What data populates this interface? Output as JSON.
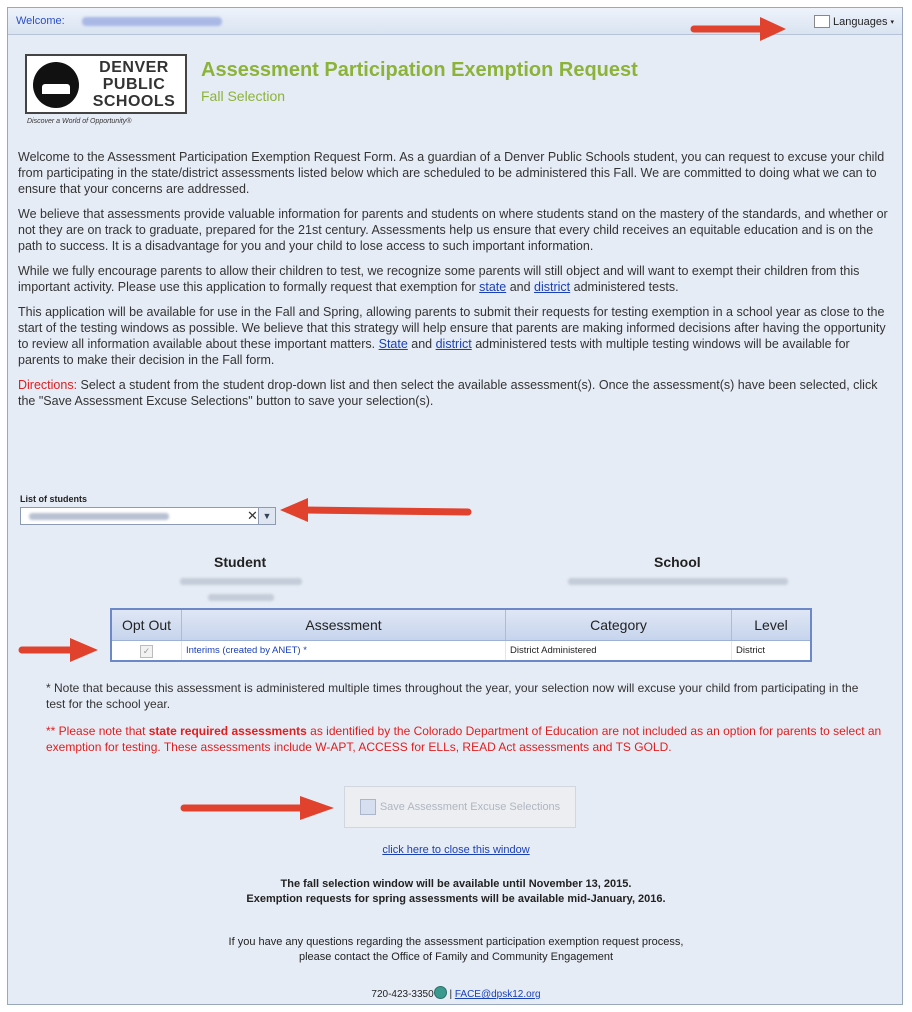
{
  "header": {
    "welcome_label": "Welcome:",
    "languages_label": "Languages"
  },
  "logo": {
    "line1": "DENVER",
    "line2": "PUBLIC",
    "line3": "SCHOOLS",
    "tagline": "Discover a World of Opportunity®"
  },
  "page": {
    "title": "Assessment Participation Exemption Request",
    "subtitle": "Fall Selection"
  },
  "intro": {
    "p1": "Welcome to the Assessment Participation Exemption Request Form. As a guardian of a Denver Public Schools student, you can request to excuse your child from participating in the state/district assessments listed below which are scheduled to be administered this Fall. We are committed to doing what we can to ensure that your concerns are addressed.",
    "p2": "We believe that assessments provide valuable information for parents and students on where students stand on the mastery of the standards, and whether or not they are on track to graduate, prepared for the 21st century. Assessments help us ensure that every child receives an equitable education and is on the path to success. It is a disadvantage for you and your child to lose access to such important information.",
    "p3_a": "While we fully encourage parents to allow their children to test, we recognize some parents will still object and will want to exempt their children from this important activity. Please use this application to formally request that exemption for ",
    "p3_link1": "state",
    "p3_and": " and ",
    "p3_link2": "district",
    "p3_b": " administered tests.",
    "p4_a": "This application will be available for use in the Fall and Spring, allowing parents to submit their requests for testing exemption in a school year as close to the start of the testing windows as possible. We believe that this strategy will help ensure that parents are making informed decisions after having the opportunity to review all information available about these important matters. ",
    "p4_link1": "State",
    "p4_and": " and ",
    "p4_link2": "district",
    "p4_b": " administered tests with multiple testing windows will be available for parents to make their decision in the Fall form.",
    "directions_label": "Directions:",
    "directions_text": " Select a student from the student drop-down list and then select the available assessment(s). Once the assessment(s) have been selected, click the \"Save Assessment Excuse Selections\" button to save your selection(s)."
  },
  "students": {
    "label": "List of students",
    "clear_glyph": "✕",
    "arrow_glyph": "▼"
  },
  "summary": {
    "student_header": "Student",
    "school_header": "School"
  },
  "grid": {
    "columns": [
      "Opt Out",
      "Assessment",
      "Category",
      "Level"
    ],
    "rows": [
      {
        "opt_out_glyph": "✓",
        "assessment": "Interims (created by ANET) *",
        "category": "District Administered",
        "level": "District"
      }
    ]
  },
  "notes": {
    "note1": "* Note that because this assessment is administered multiple times throughout the year, your selection now will excuse your child from participating in the test for the school year.",
    "note2_a": "** Please note that ",
    "note2_bold": "state required assessments",
    "note2_b": " as identified by the Colorado Department of Education are not included as an option for parents to select an exemption for testing. These assessments include W-APT, ACCESS for ELLs, READ Act assessments and TS GOLD."
  },
  "actions": {
    "save_label": "Save Assessment Excuse Selections",
    "close_link": "click here to close this window"
  },
  "footer": {
    "window_line1": "The fall selection window will be available until November 13, 2015.",
    "window_line2": "Exemption requests for spring assessments will be available mid-January, 2016.",
    "questions_line1": "If you have any questions regarding the assessment participation exemption request process,",
    "questions_line2": "please contact the Office of Family and Community Engagement",
    "phone": "720-423-3350",
    "separator": "|",
    "email": "FACE@dpsk12.org"
  },
  "colors": {
    "title_green": "#8cb339",
    "link_blue": "#1a3fb5",
    "alert_red": "#e01e1e",
    "annotation_arrow": "#e0422e"
  }
}
